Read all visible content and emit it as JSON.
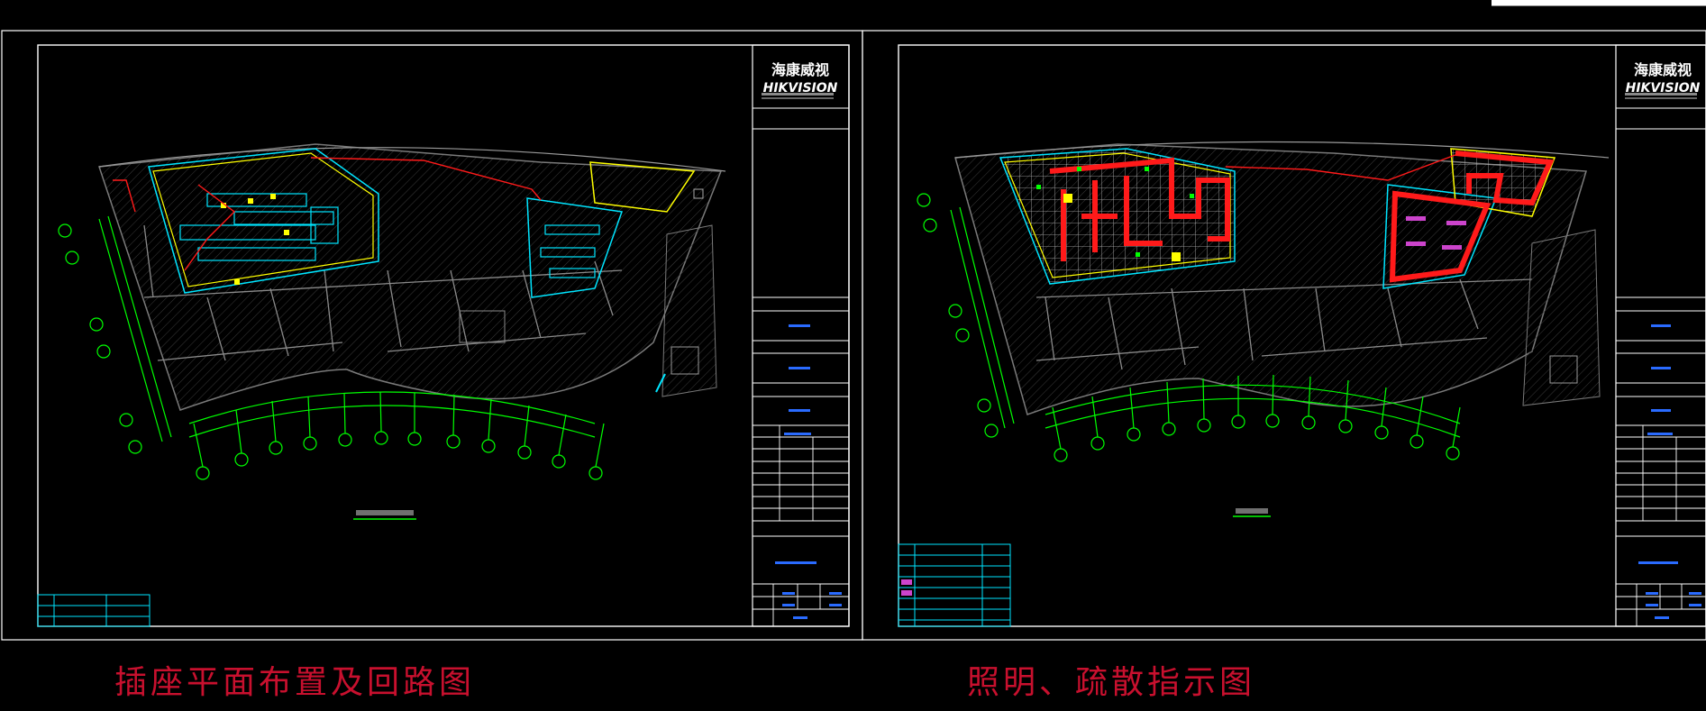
{
  "brand": {
    "logo_cn": "海康威视",
    "logo_en": "HIKVISION"
  },
  "captions": {
    "left": "插座平面布置及回路图",
    "right": "照明、疏散指示图"
  },
  "colors": {
    "background": "#000000",
    "frame": "#ffffff",
    "wall": "#7a7a7a",
    "axis": "#00ff00",
    "device": "#00e5ff",
    "circuit": "#ff1a1a",
    "boundary": "#ffff00",
    "label_blue": "#2a6bff",
    "caption": "#c8102e"
  }
}
